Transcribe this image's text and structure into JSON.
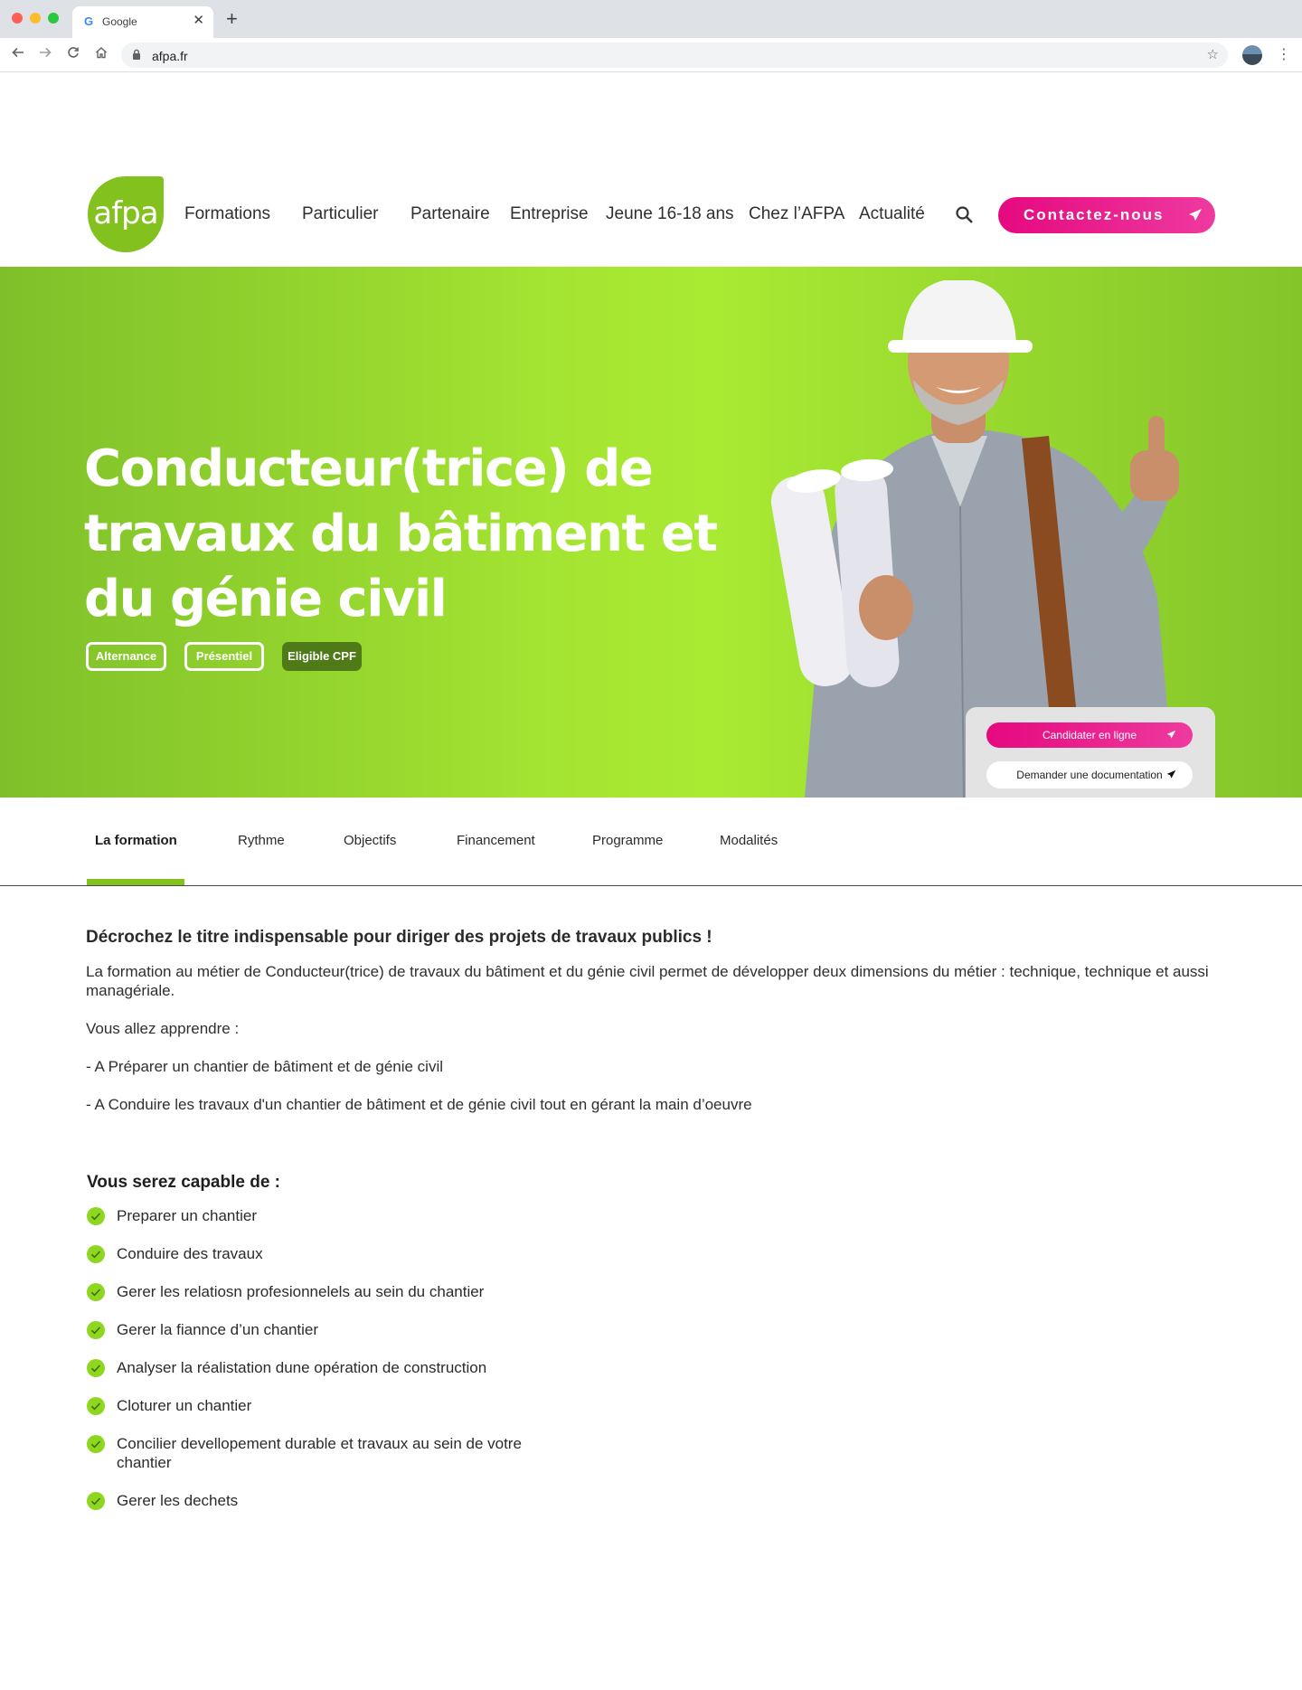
{
  "browser": {
    "tab_title": "Google",
    "tab_favicon": "G",
    "tab_close": "✕",
    "new_tab": "+",
    "url": "afpa.fr",
    "icons": [
      "back-arrow-icon",
      "forward-arrow-icon",
      "reload-icon",
      "home-icon",
      "lock-icon",
      "star-icon",
      "profile-avatar",
      "kebab-menu-icon"
    ]
  },
  "header": {
    "logo_text": "afpa",
    "nav": [
      "Formations",
      "Particulier",
      "Partenaire",
      "Entreprise",
      "Jeune 16-18 ans",
      "Chez l’AFPA",
      "Actualité"
    ],
    "contact_label": "Contactez-nous"
  },
  "hero": {
    "title_line1": "Conducteur(trice) de",
    "title_line2": "travaux du bâtiment et",
    "title_line3": "du génie civil",
    "badges": [
      "Alternance",
      "Présentiel",
      "Eligible CPF"
    ],
    "apply_label": "Candidater en ligne",
    "doc_label": "Demander une documentation"
  },
  "tabs": [
    "La formation",
    "Rythme",
    "Objectifs",
    "Financement",
    "Programme",
    "Modalités"
  ],
  "active_tab": "La formation",
  "content": {
    "intro_heading": "Décrochez le titre indispensable pour diriger des projets de travaux publics !",
    "intro_para": "La formation au métier de Conducteur(trice) de travaux du bâtiment et du génie civil permet de développer deux dimensions du métier : technique, technique et aussi managériale.",
    "learn_intro": "Vous allez apprendre :",
    "learn_items": [
      "-  A Préparer un chantier de bâtiment et de génie civil",
      "-  A Conduire les travaux d'un chantier de bâtiment et de génie civil tout en gérant la main d’oeuvre"
    ],
    "capable_heading": "Vous serez capable de :",
    "capable_items": [
      "Preparer un chantier",
      "Conduire des travaux",
      "Gerer les relatiosn profesionnelels au sein du chantier",
      "Gerer la fiannce d’un chantier",
      "Analyser la réalistation dune opération de construction",
      "Cloturer un chantier",
      "Concilier devellopement durable et travaux au sein de votre chantier",
      "Gerer les dechets"
    ]
  },
  "colors": {
    "brand_green": "#83c11f",
    "hero_green_light": "#a9ea33",
    "brand_pink": "#e5097f",
    "badge_dark": "#4f7a18"
  }
}
